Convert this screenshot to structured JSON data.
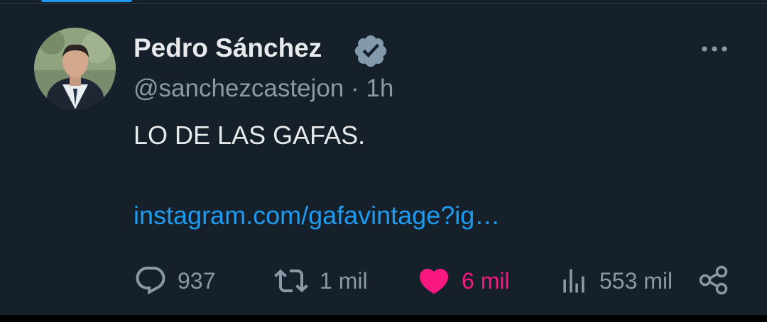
{
  "tweet": {
    "author_name": "Pedro Sánchez",
    "handle": "@sanchezcastejon",
    "separator": "·",
    "time": "1h",
    "text": "LO DE LAS GAFAS.",
    "link": "instagram.com/gafavintage?ig…"
  },
  "actions": {
    "replies": "937",
    "retweets": "1 mil",
    "likes": "6 mil",
    "views": "553 mil"
  },
  "icons": {
    "verified": "verified-badge-icon",
    "more": "more-options-icon",
    "reply": "reply-icon",
    "retweet": "retweet-icon",
    "like": "heart-icon",
    "views": "views-icon",
    "share": "share-icon"
  },
  "colors": {
    "background": "#15202b",
    "accent_link": "#1d9bf0",
    "like_active": "#f91880",
    "text_primary": "#e7e9ea",
    "text_secondary": "#8b98a5"
  }
}
